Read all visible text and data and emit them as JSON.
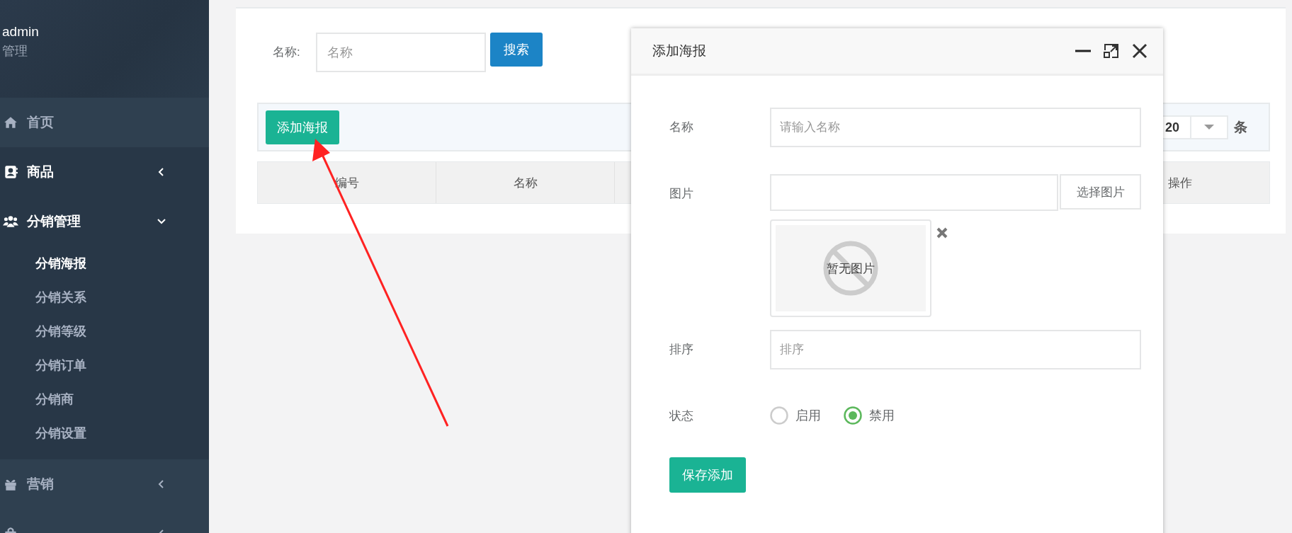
{
  "sidebar": {
    "user": {
      "name": "admin",
      "role": "管理"
    },
    "items": [
      {
        "label": "首页",
        "kind": "link",
        "active": false
      },
      {
        "label": "商品",
        "kind": "group",
        "active": true,
        "expanded": false
      },
      {
        "label": "分销管理",
        "kind": "group",
        "active": true,
        "expanded": true,
        "children": [
          {
            "label": "分销海报",
            "selected": true
          },
          {
            "label": "分销关系",
            "selected": false
          },
          {
            "label": "分销等级",
            "selected": false
          },
          {
            "label": "分销订单",
            "selected": false
          },
          {
            "label": "分销商",
            "selected": false
          },
          {
            "label": "分销设置",
            "selected": false
          }
        ]
      },
      {
        "label": "营销",
        "kind": "group",
        "active": false,
        "expanded": false
      },
      {
        "kind": "group",
        "active": false,
        "expanded": false
      }
    ]
  },
  "search": {
    "label": "名称:",
    "placeholder": "名称",
    "button": "搜索"
  },
  "toolbar": {
    "add_button": "添加海报",
    "page_size": "20",
    "page_size_unit": "条"
  },
  "table": {
    "columns": [
      {
        "label": "编号"
      },
      {
        "label": "名称"
      },
      {
        "label": "操作"
      }
    ]
  },
  "dialog": {
    "title": "添加海报",
    "fields": [
      {
        "kind": "text",
        "label": "名称",
        "placeholder": "请输入名称"
      },
      {
        "kind": "image",
        "label": "图片",
        "button": "选择图片",
        "empty_text": "暂无图片"
      },
      {
        "kind": "text",
        "label": "排序",
        "placeholder": "排序"
      },
      {
        "kind": "radio",
        "label": "状态",
        "options": [
          {
            "label": "启用",
            "selected": false
          },
          {
            "label": "禁用",
            "selected": true
          }
        ]
      }
    ],
    "submit": "保存添加"
  }
}
